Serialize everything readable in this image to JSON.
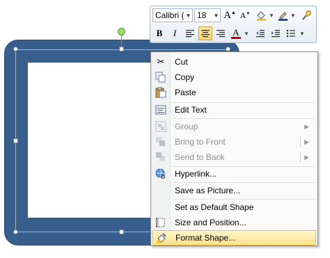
{
  "mini_toolbar": {
    "font_name": "Calibri (E",
    "font_size": "18",
    "grow_font_icon": "font-grow-icon",
    "shrink_font_icon": "font-shrink-icon",
    "format_painter_icon": "format-painter-icon",
    "bold": "B",
    "italic": "I",
    "font_color_letter": "A",
    "accent_red": "#c00000",
    "active_button": "center-align"
  },
  "menu": {
    "items": [
      {
        "label": "Cut",
        "icon": "scissors-icon",
        "enabled": true
      },
      {
        "label": "Copy",
        "icon": "copy-icon",
        "enabled": true
      },
      {
        "label": "Paste",
        "icon": "paste-icon",
        "enabled": true
      },
      {
        "label": "Edit Text",
        "icon": "edit-text-icon",
        "enabled": true
      },
      {
        "label": "Group",
        "icon": "group-icon",
        "enabled": false
      },
      {
        "label": "Bring to Front",
        "icon": "bring-to-front-icon",
        "enabled": false
      },
      {
        "label": "Send to Back",
        "icon": "send-to-back-icon",
        "enabled": false
      },
      {
        "label": "Hyperlink...",
        "icon": "hyperlink-icon",
        "enabled": true
      },
      {
        "label": "Save as Picture...",
        "enabled": true
      },
      {
        "label": "Set as Default Shape",
        "enabled": true
      },
      {
        "label": "Size and Position...",
        "icon": "size-position-icon",
        "enabled": true
      },
      {
        "label": "Format Shape...",
        "icon": "format-shape-icon",
        "enabled": true,
        "highlighted": true
      }
    ]
  },
  "colors": {
    "shape_fill": "#375e8c",
    "highlight": "#fde28c"
  }
}
